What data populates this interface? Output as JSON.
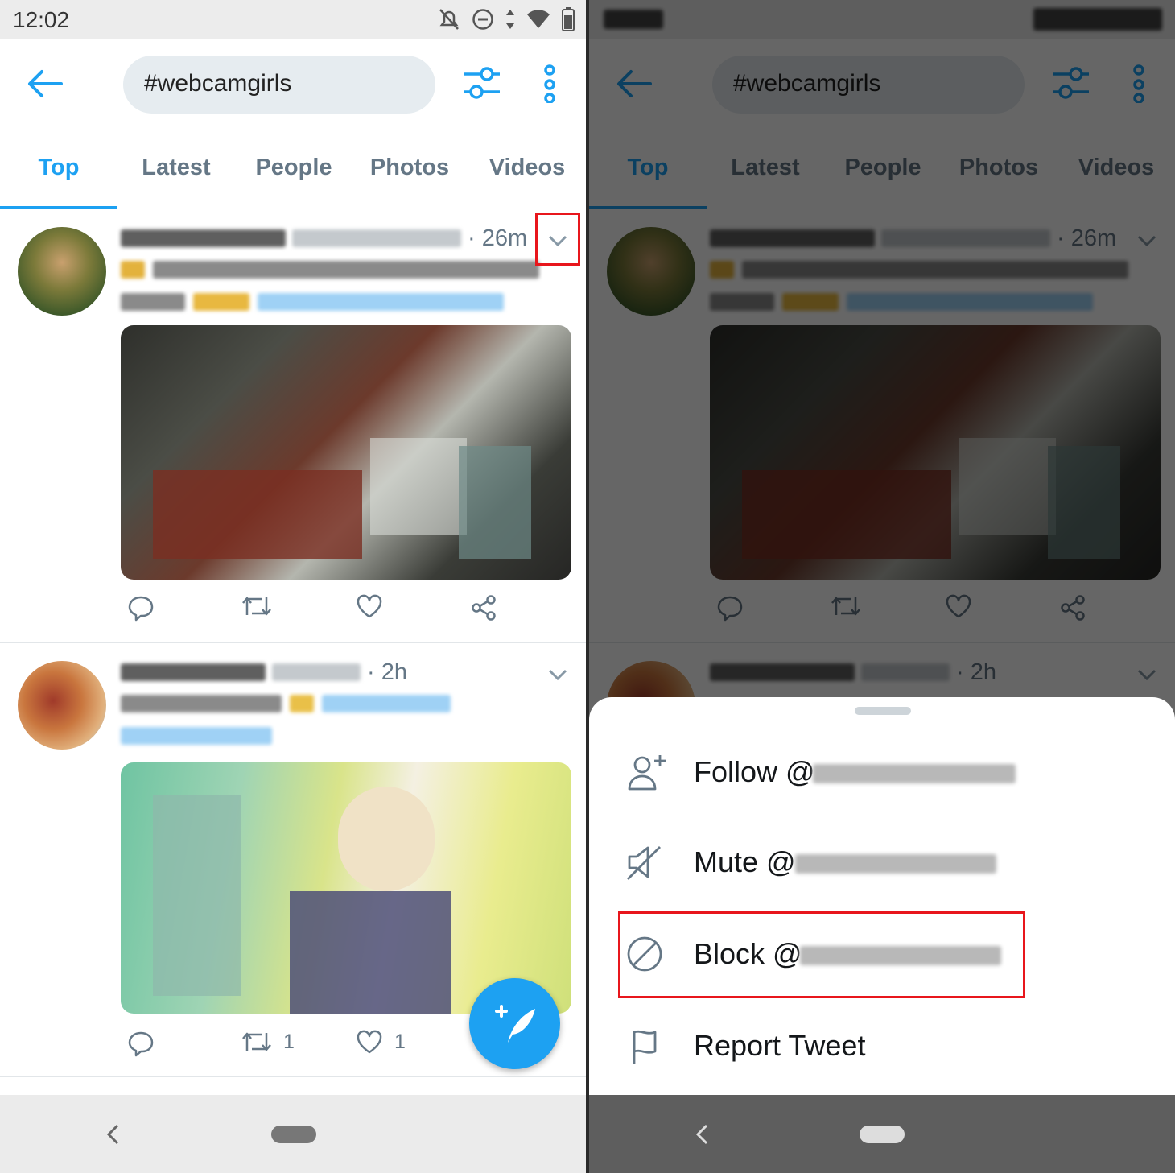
{
  "status": {
    "time": "12:02"
  },
  "search": {
    "query": "#webcamgirls"
  },
  "tabs": [
    {
      "label": "Top"
    },
    {
      "label": "Latest"
    },
    {
      "label": "People"
    },
    {
      "label": "Photos"
    },
    {
      "label": "Videos"
    }
  ],
  "tweets": [
    {
      "timestamp": "· 26m",
      "retweets": "",
      "likes": ""
    },
    {
      "timestamp": "· 2h",
      "retweets": "1",
      "likes": "1"
    }
  ],
  "menu": {
    "items": [
      {
        "label": "Follow @",
        "icon": "follow-icon"
      },
      {
        "label": "Mute @",
        "icon": "mute-icon"
      },
      {
        "label": "Block @",
        "icon": "block-icon"
      },
      {
        "label": "Report Tweet",
        "icon": "flag-icon"
      }
    ]
  },
  "colors": {
    "accent": "#1da1f2",
    "highlight": "#e8161c",
    "secondary_text": "#657786"
  }
}
